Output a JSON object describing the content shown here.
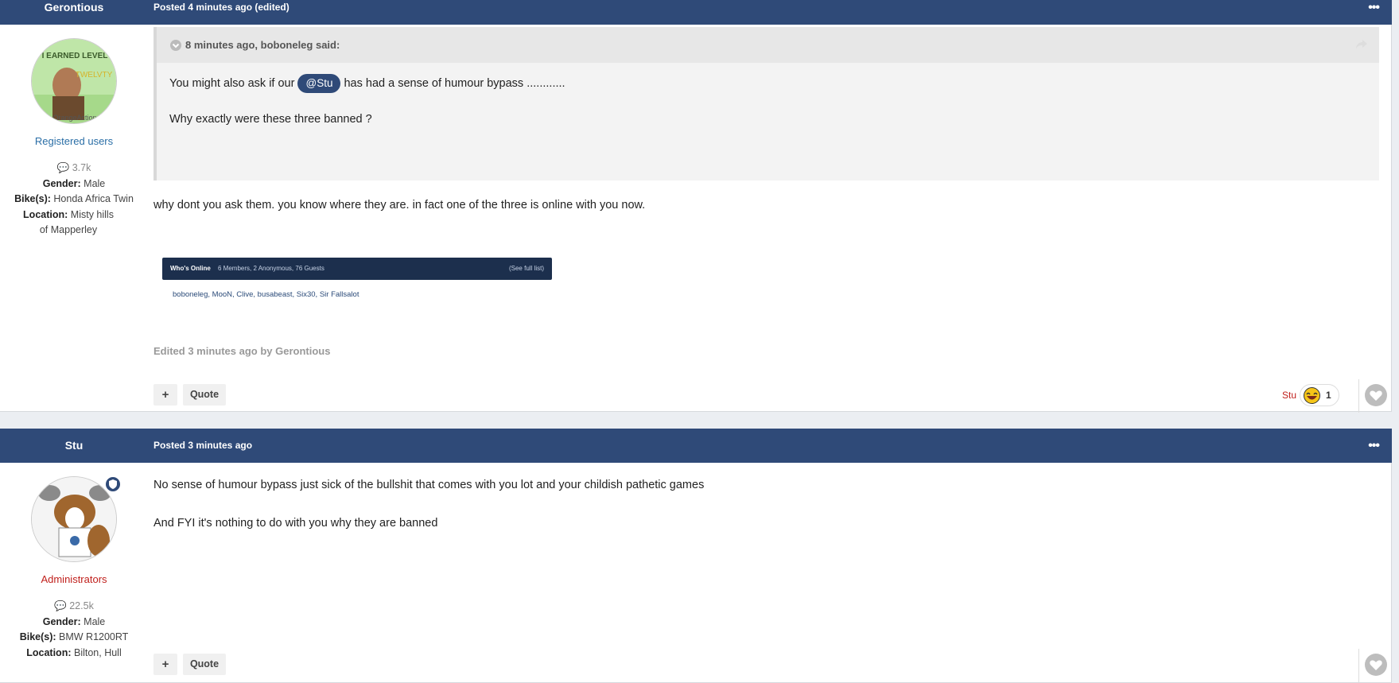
{
  "post1": {
    "author": "Gerontious",
    "posted": "Posted 4 minutes ago (edited)",
    "menu": "•••",
    "avatar_badge_text": "I EARNED LEVEL TWELVTY / OrangeAction",
    "group": "Registered users",
    "post_count": "3.7k",
    "gender_label": "Gender:",
    "gender": "Male",
    "bike_label": "Bike(s):",
    "bike": "Honda Africa Twin",
    "location_label": "Location:",
    "location": "Misty hills of Mapperley",
    "quote": {
      "header": "8 minutes ago, boboneleg said:",
      "line1_before": "You might also ask if our",
      "mention": "@Stu",
      "line1_after": "has had a sense of humour bypass ............",
      "line2": "Why exactly were these three banned ?"
    },
    "body": "why dont you ask them. you know where they are. in fact one of the three is online with you now.",
    "embedded": {
      "title": "Who's Online",
      "summary": "6 Members, 2 Anonymous, 76 Guests",
      "link": "(See full list)",
      "members": "boboneleg, MooN, Clive, busabeast, Six30, Sir Fallsalot"
    },
    "edited": "Edited 3 minutes ago by Gerontious",
    "plus_label": "+",
    "quote_label": "Quote",
    "reaction_user": "Stu",
    "reaction_count": "1"
  },
  "post2": {
    "author": "Stu",
    "posted": "Posted 3 minutes ago",
    "menu": "•••",
    "group": "Administrators",
    "post_count": "22.5k",
    "gender_label": "Gender:",
    "gender": "Male",
    "bike_label": "Bike(s):",
    "bike": "BMW R1200RT",
    "location_label": "Location:",
    "location": "Bilton, Hull",
    "body_line1": "No sense of humour bypass just sick of the bullshit that comes with you lot and your childish pathetic games",
    "body_line2": "And FYI it's nothing to do with you why they are banned",
    "plus_label": "+",
    "quote_label": "Quote"
  },
  "colors": {
    "header": "#2f4a78",
    "registered": "#2a6ea6",
    "admin": "#c0201c",
    "quote_bg": "#f3f3f3"
  }
}
